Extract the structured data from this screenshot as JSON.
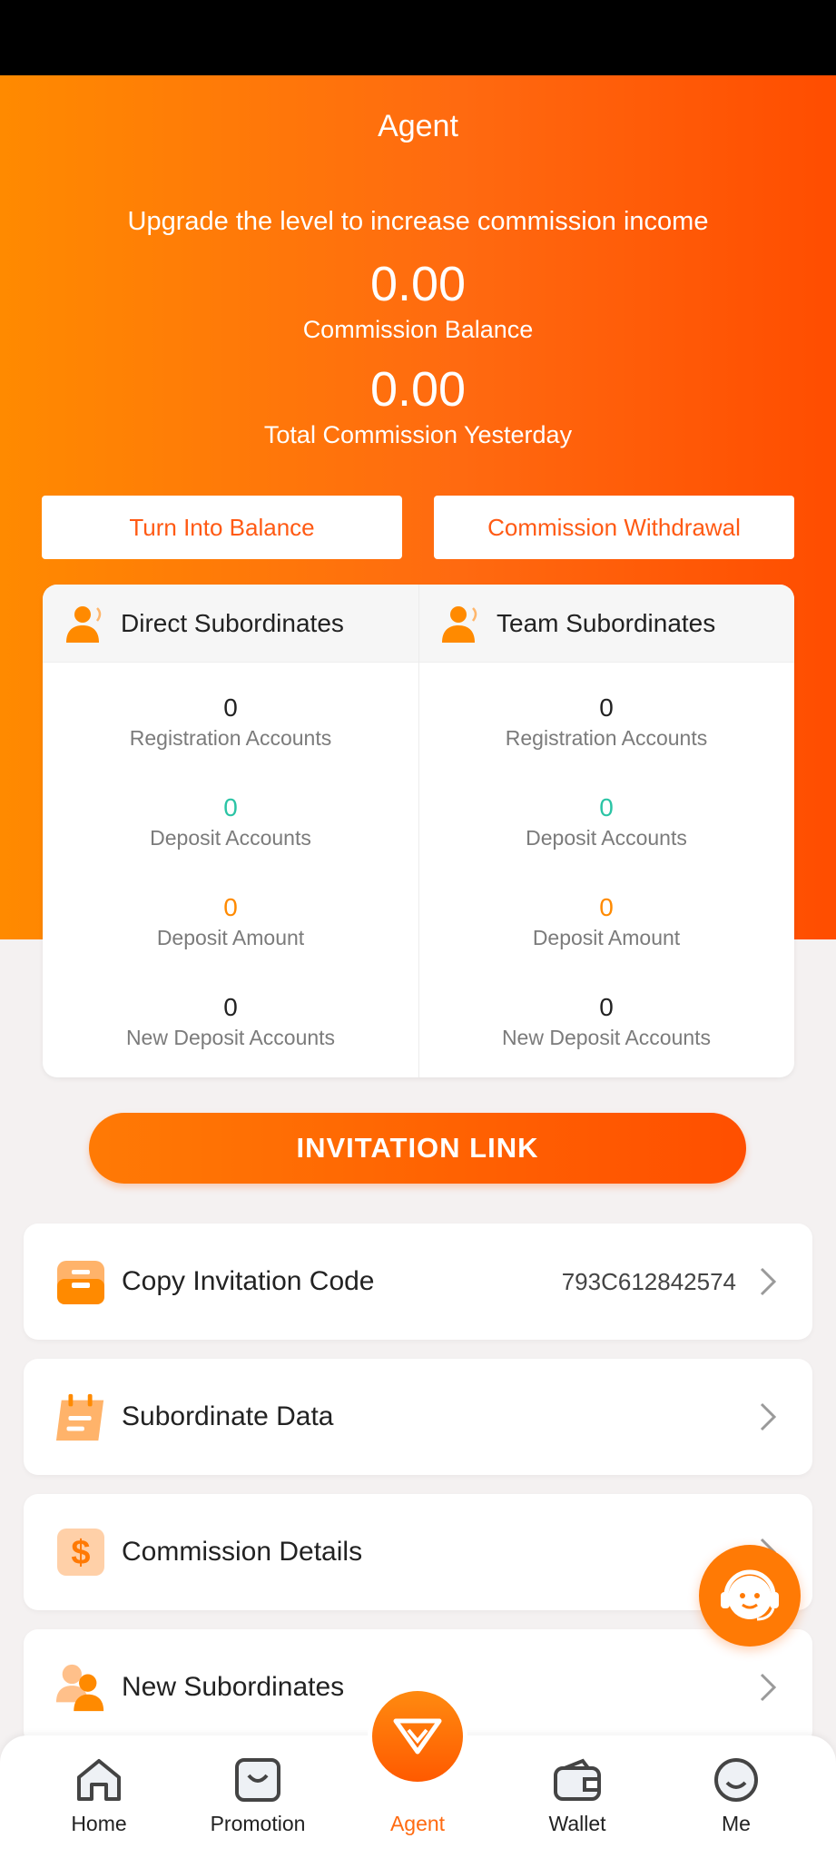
{
  "header": {
    "title": "Agent",
    "subtitle": "Upgrade the level to increase commission income",
    "commission_balance_value": "0.00",
    "commission_balance_label": "Commission Balance",
    "yesterday_value": "0.00",
    "yesterday_label": "Total Commission Yesterday"
  },
  "actions": {
    "turn_into_balance": "Turn Into Balance",
    "commission_withdrawal": "Commission Withdrawal"
  },
  "stats": {
    "direct": {
      "title": "Direct Subordinates",
      "items": [
        {
          "value": "0",
          "label": "Registration Accounts"
        },
        {
          "value": "0",
          "label": "Deposit Accounts"
        },
        {
          "value": "0",
          "label": "Deposit Amount"
        },
        {
          "value": "0",
          "label": "New Deposit Accounts"
        }
      ]
    },
    "team": {
      "title": "Team Subordinates",
      "items": [
        {
          "value": "0",
          "label": "Registration Accounts"
        },
        {
          "value": "0",
          "label": "Deposit Accounts"
        },
        {
          "value": "0",
          "label": "Deposit Amount"
        },
        {
          "value": "0",
          "label": "New Deposit Accounts"
        }
      ]
    }
  },
  "invite_button": "INVITATION LINK",
  "menu": [
    {
      "label": "Copy Invitation Code",
      "value": "793C612842574",
      "icon": "inbox-icon"
    },
    {
      "label": "Subordinate Data",
      "icon": "calendar-icon"
    },
    {
      "label": "Commission Details",
      "icon": "dollar-icon"
    },
    {
      "label": "New Subordinates",
      "icon": "users-icon"
    }
  ],
  "tabs": [
    {
      "label": "Home",
      "icon": "home-icon"
    },
    {
      "label": "Promotion",
      "icon": "shopping-bag-icon"
    },
    {
      "label": "Agent",
      "icon": "diamond-icon",
      "active": true
    },
    {
      "label": "Wallet",
      "icon": "wallet-icon"
    },
    {
      "label": "Me",
      "icon": "smile-icon"
    }
  ],
  "colors": {
    "accent": "#ff6a10",
    "teal": "#2bc4a5",
    "orange_value": "#ff8a00"
  }
}
